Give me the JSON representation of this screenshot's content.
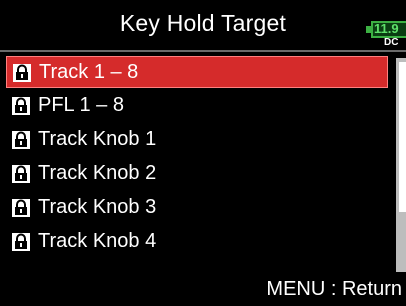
{
  "header": {
    "title": "Key Hold Target"
  },
  "battery": {
    "value": "11.9",
    "source": "DC",
    "color": "#3cb043"
  },
  "list": {
    "selected_index": 0,
    "items": [
      {
        "label": "Track 1 – 8",
        "icon": "lock-icon"
      },
      {
        "label": "PFL 1 – 8",
        "icon": "lock-icon"
      },
      {
        "label": "Track Knob 1",
        "icon": "lock-icon"
      },
      {
        "label": "Track Knob 2",
        "icon": "lock-icon"
      },
      {
        "label": "Track Knob 3",
        "icon": "lock-icon"
      },
      {
        "label": "Track Knob 4",
        "icon": "lock-icon"
      }
    ]
  },
  "footer": {
    "hint": "MENU : Return"
  },
  "colors": {
    "selection": "#d52b2b",
    "background": "#000000",
    "text": "#ffffff"
  }
}
